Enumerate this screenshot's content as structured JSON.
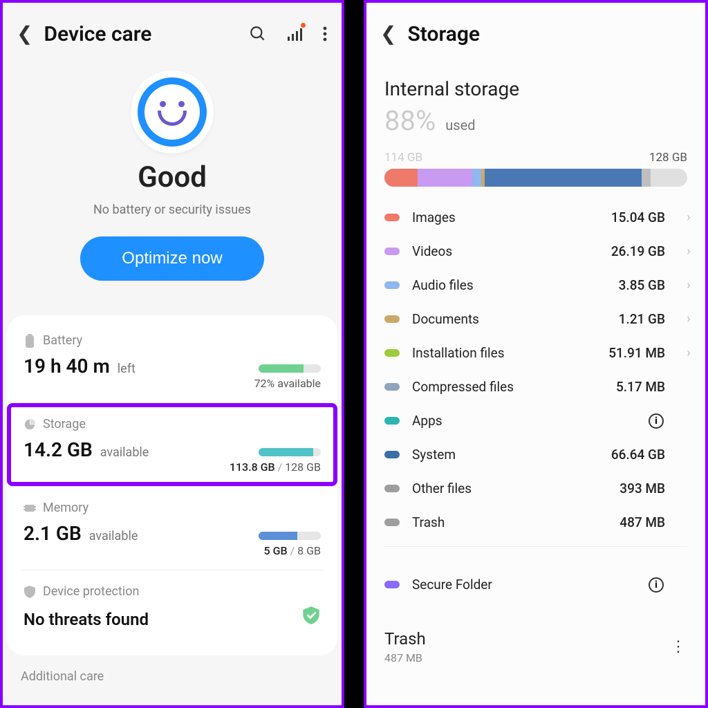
{
  "left": {
    "title": "Device care",
    "status": "Good",
    "subtitle": "No battery or security issues",
    "optimize": "Optimize now",
    "battery": {
      "label": "Battery",
      "value": "19 h 40 m",
      "value_suffix": "left",
      "right": "72% available",
      "bar_pct": 72,
      "bar_color": "#6fd18f"
    },
    "storage": {
      "label": "Storage",
      "value": "14.2 GB",
      "value_suffix": "available",
      "used": "113.8 GB",
      "total": "128 GB",
      "bar_pct": 88,
      "bar_color": "#4fc3c7"
    },
    "memory": {
      "label": "Memory",
      "value": "2.1 GB",
      "value_suffix": "available",
      "used": "5 GB",
      "total": "8 GB",
      "bar_pct": 62,
      "bar_color": "#5b8fd6"
    },
    "protection": {
      "label": "Device protection",
      "value": "No threats found"
    },
    "additional": "Additional care"
  },
  "right": {
    "title": "Storage",
    "section": "Internal storage",
    "percent": "88%",
    "percent_label": "used",
    "range_used": "114 GB",
    "range_total": "128 GB",
    "segments": [
      {
        "color": "#f07a6a",
        "pct": 11
      },
      {
        "color": "#c99af2",
        "pct": 18
      },
      {
        "color": "#8fb7f0",
        "pct": 3
      },
      {
        "color": "#c9a96a",
        "pct": 1
      },
      {
        "color": "#4a78b5",
        "pct": 52
      },
      {
        "color": "#bfbfbf",
        "pct": 3
      }
    ],
    "categories": [
      {
        "name": "Images",
        "value": "15.04 GB",
        "color": "#f07a6a",
        "chev": true
      },
      {
        "name": "Videos",
        "value": "26.19 GB",
        "color": "#c99af2",
        "chev": true
      },
      {
        "name": "Audio files",
        "value": "3.85 GB",
        "color": "#8fb7f0",
        "chev": true
      },
      {
        "name": "Documents",
        "value": "1.21 GB",
        "color": "#c9a96a",
        "chev": true
      },
      {
        "name": "Installation files",
        "value": "51.91 MB",
        "color": "#9ccc3c",
        "chev": true
      },
      {
        "name": "Compressed files",
        "value": "5.17 MB",
        "color": "#8fa5b8",
        "chev": false
      },
      {
        "name": "Apps",
        "value": "",
        "color": "#2bb5b0",
        "info": true
      },
      {
        "name": "System",
        "value": "66.64 GB",
        "color": "#3a6ea5",
        "chev": false
      },
      {
        "name": "Other files",
        "value": "393 MB",
        "color": "#9e9e9e",
        "chev": false
      },
      {
        "name": "Trash",
        "value": "487 MB",
        "color": "#9e9e9e",
        "chev": false
      }
    ],
    "secure": {
      "name": "Secure Folder",
      "color": "#8a6aff"
    },
    "trash": {
      "title": "Trash",
      "sub": "487 MB"
    }
  }
}
